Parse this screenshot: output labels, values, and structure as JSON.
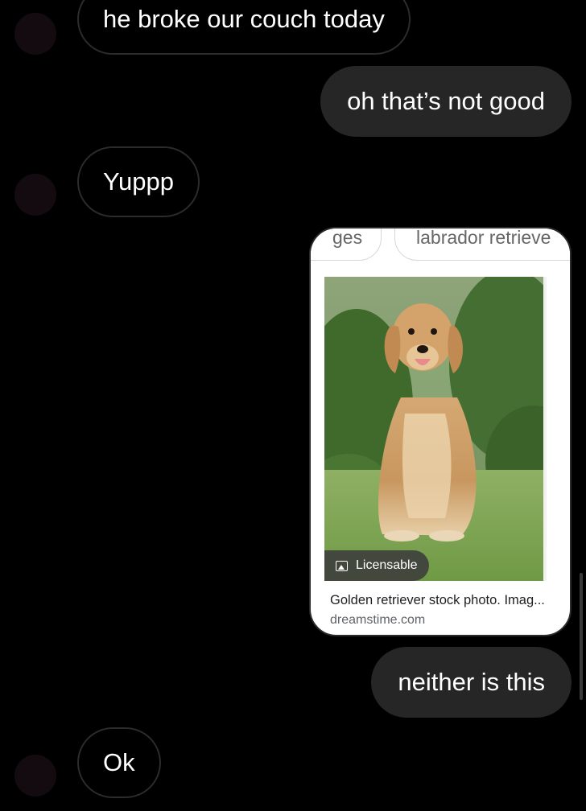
{
  "messages": [
    {
      "id": "m1",
      "direction": "incoming",
      "text": "he broke our couch today"
    },
    {
      "id": "m2",
      "direction": "outgoing",
      "text": "oh that’s not good"
    },
    {
      "id": "m3",
      "direction": "incoming",
      "text": "Yuppp"
    },
    {
      "id": "m4",
      "direction": "outgoing",
      "text": "neither is this"
    },
    {
      "id": "m5",
      "direction": "incoming",
      "text": "Ok"
    }
  ],
  "shared_image": {
    "chips": [
      "ges",
      "labrador retrieve"
    ],
    "badge": "Licensable",
    "badge_icon": "image-icon",
    "caption": "Golden retriever stock photo. Imag...",
    "source": "dreamstime.com",
    "alt": "Golden retriever sitting on grass"
  },
  "colors": {
    "background": "#000000",
    "outgoing_bubble": "#262626",
    "incoming_bubble_border": "#2b2b2b",
    "avatar": "#140b10"
  }
}
